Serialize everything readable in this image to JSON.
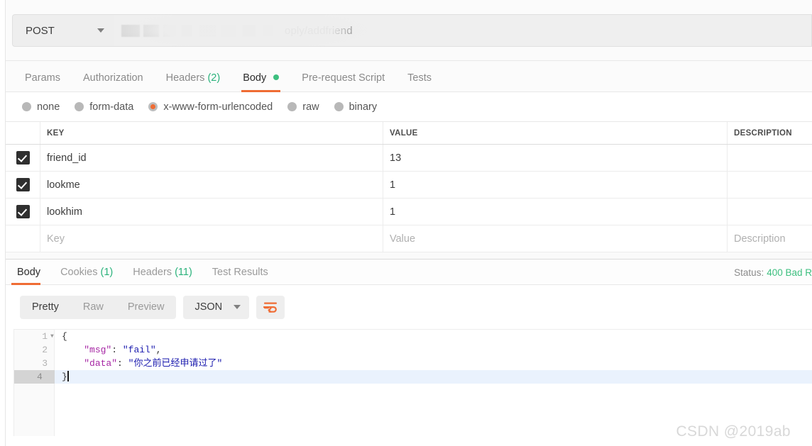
{
  "request": {
    "method": "POST",
    "url_visible_suffix": "oply/addfriend",
    "url_redacted": true,
    "tabs": [
      {
        "label": "Params",
        "active": false,
        "count": ""
      },
      {
        "label": "Authorization",
        "active": false,
        "count": ""
      },
      {
        "label": "Headers",
        "active": false,
        "count": "(2)"
      },
      {
        "label": "Body",
        "active": true,
        "count": "",
        "dot": true
      },
      {
        "label": "Pre-request Script",
        "active": false,
        "count": ""
      },
      {
        "label": "Tests",
        "active": false,
        "count": ""
      }
    ],
    "body_types": [
      {
        "label": "none",
        "selected": false
      },
      {
        "label": "form-data",
        "selected": false
      },
      {
        "label": "x-www-form-urlencoded",
        "selected": true
      },
      {
        "label": "raw",
        "selected": false
      },
      {
        "label": "binary",
        "selected": false
      }
    ],
    "table": {
      "headers": {
        "key": "KEY",
        "value": "VALUE",
        "description": "DESCRIPTION"
      },
      "placeholders": {
        "key": "Key",
        "value": "Value",
        "description": "Description"
      },
      "rows": [
        {
          "checked": true,
          "key": "friend_id",
          "value": "13",
          "description": ""
        },
        {
          "checked": true,
          "key": "lookme",
          "value": "1",
          "description": ""
        },
        {
          "checked": true,
          "key": "lookhim",
          "value": "1",
          "description": ""
        }
      ]
    }
  },
  "response": {
    "tabs": [
      {
        "label": "Body",
        "active": true,
        "count": ""
      },
      {
        "label": "Cookies",
        "active": false,
        "count": "(1)"
      },
      {
        "label": "Headers",
        "active": false,
        "count": "(11)"
      },
      {
        "label": "Test Results",
        "active": false,
        "count": ""
      }
    ],
    "status_label": "Status:",
    "status_value": "400 Bad R",
    "view_modes": [
      {
        "label": "Pretty",
        "active": true
      },
      {
        "label": "Raw",
        "active": false
      },
      {
        "label": "Preview",
        "active": false
      }
    ],
    "format": "JSON",
    "body_lines": [
      {
        "n": "1",
        "fold": true,
        "active": false,
        "parts": [
          {
            "t": "{",
            "c": "jpunc"
          }
        ]
      },
      {
        "n": "2",
        "fold": false,
        "active": false,
        "parts": [
          {
            "t": "    ",
            "c": "jpunc"
          },
          {
            "t": "\"msg\"",
            "c": "jkey"
          },
          {
            "t": ": ",
            "c": "jpunc"
          },
          {
            "t": "\"fail\"",
            "c": "jstr"
          },
          {
            "t": ",",
            "c": "jpunc"
          }
        ]
      },
      {
        "n": "3",
        "fold": false,
        "active": false,
        "parts": [
          {
            "t": "    ",
            "c": "jpunc"
          },
          {
            "t": "\"data\"",
            "c": "jkey"
          },
          {
            "t": ": ",
            "c": "jpunc"
          },
          {
            "t": "\"你之前已经申请过了\"",
            "c": "jstr"
          }
        ]
      },
      {
        "n": "4",
        "fold": false,
        "active": true,
        "cursor": true,
        "parts": [
          {
            "t": "}",
            "c": "jpunc"
          }
        ]
      }
    ],
    "body_raw": {
      "msg": "fail",
      "data": "你之前已经申请过了"
    }
  },
  "watermark": "CSDN @2019ab",
  "colors": {
    "accent": "#ef6c34",
    "success": "#3dbf7f",
    "json_key": "#a626a4",
    "json_string": "#1a1aae",
    "checkbox": "#2f2f2f"
  }
}
